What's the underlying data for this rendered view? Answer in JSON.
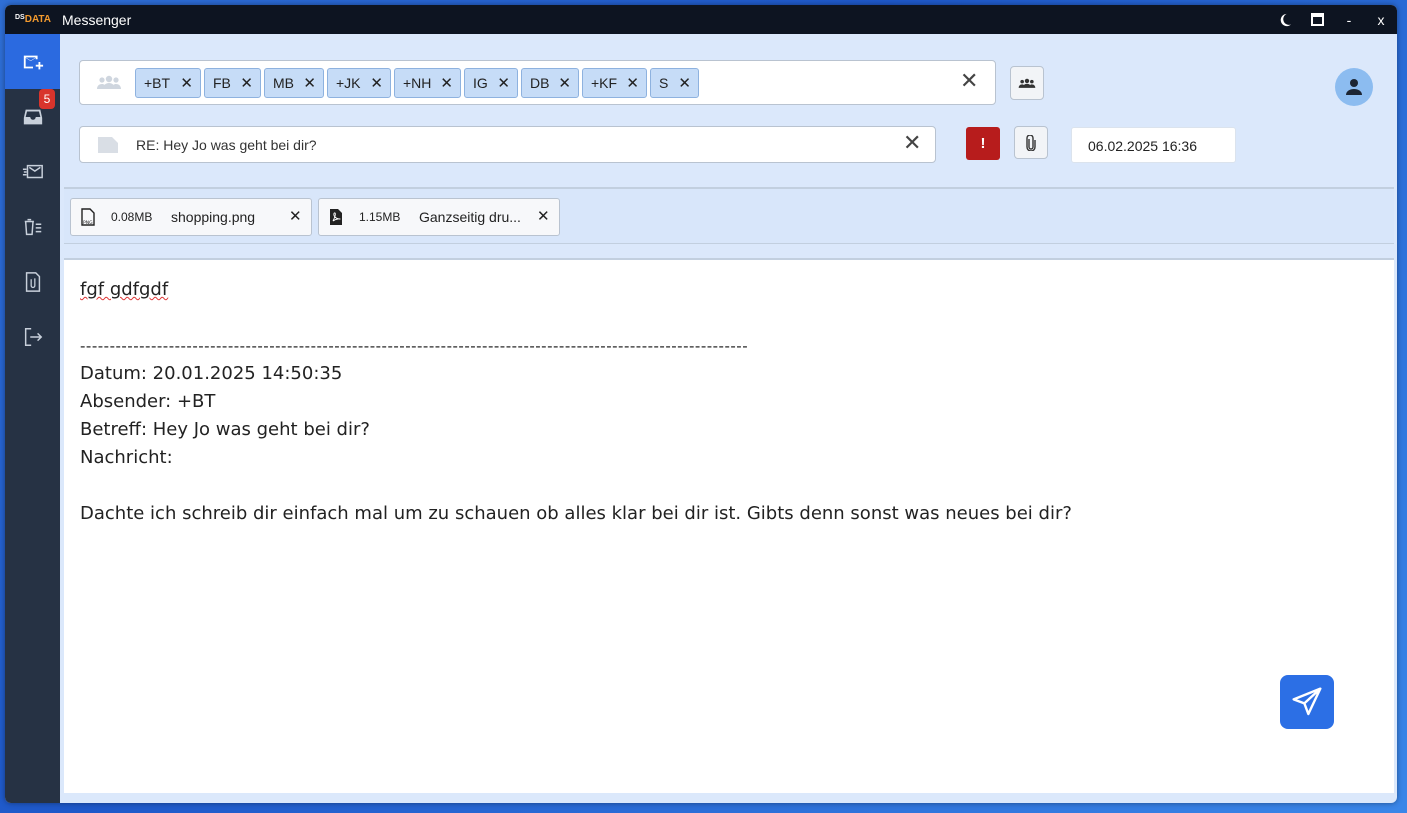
{
  "titlebar": {
    "logo_ds": "DS",
    "logo_data": "DATA",
    "title": "Messenger",
    "controls": {
      "theme_icon": "moon-icon",
      "maximize_icon": "maximize-icon",
      "minimize_label": "-",
      "close_label": "x"
    }
  },
  "sidebar": {
    "items": [
      {
        "icon": "compose-mail-icon",
        "active": true
      },
      {
        "icon": "inbox-icon",
        "badge": "5"
      },
      {
        "icon": "sent-mail-icon"
      },
      {
        "icon": "delete-list-icon"
      },
      {
        "icon": "attachments-icon"
      },
      {
        "icon": "logout-icon"
      }
    ]
  },
  "recipients": {
    "icon": "group-icon",
    "chips": [
      {
        "label": "+BT"
      },
      {
        "label": "FB"
      },
      {
        "label": "MB"
      },
      {
        "label": "+JK"
      },
      {
        "label": "+NH"
      },
      {
        "label": "IG"
      },
      {
        "label": "DB"
      },
      {
        "label": "+KF"
      },
      {
        "label": "S"
      }
    ],
    "chip_remove": "✕",
    "clear": "✕",
    "contacts_icon": "contacts-icon"
  },
  "subject": {
    "icon": "document-icon",
    "value": "RE: Hey Jo was geht bei dir?",
    "clear": "✕",
    "priority_label": "!",
    "attach_icon": "paperclip-icon",
    "datetime": "06.02.2025 16:36"
  },
  "user": {
    "avatar_icon": "user-icon"
  },
  "attachments": [
    {
      "type_icon": "png-file-icon",
      "size": "0.08MB",
      "name": "shopping.png",
      "remove": "✕"
    },
    {
      "type_icon": "pdf-file-icon",
      "size": "1.15MB",
      "name": "Ganzseitig dru...",
      "remove": "✕"
    }
  ],
  "message": {
    "line1": "fgf gdfgdf",
    "separator": "-----------------------------------------------------------------------------------------------------------------",
    "datum": "Datum: 20.01.2025 14:50:35",
    "absender": "Absender: +BT",
    "betreff": "Betreff: Hey Jo was geht bei dir?",
    "nachricht": "Nachricht:",
    "body": "Dachte ich schreib dir einfach mal um zu schauen ob alles klar bei dir ist. Gibts denn sonst was neues bei dir?"
  },
  "send": {
    "icon": "send-icon"
  },
  "colors": {
    "accent": "#2c6fe5",
    "sidebar": "#263244",
    "titlebar": "#0d1421",
    "priority": "#b71c1c",
    "badge": "#d8342c"
  }
}
